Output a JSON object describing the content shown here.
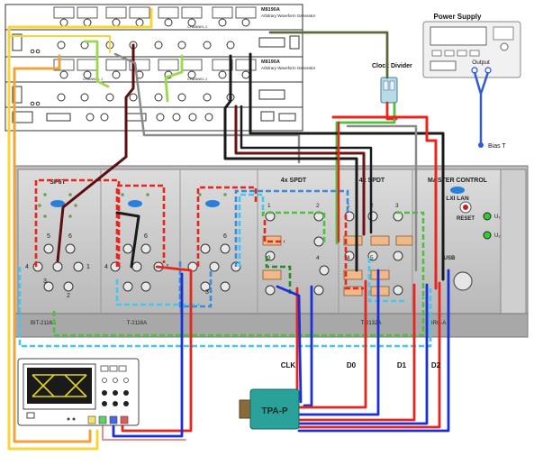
{
  "awg_units": [
    {
      "model": "M8190A",
      "subtitle": "Arbitrary Waveform Generator",
      "channel_a": "CHANNEL 1",
      "channel_b": "CHANNEL 2"
    },
    {
      "model": "M8190A",
      "subtitle": "Arbitrary Waveform Generator",
      "channel_a": "CHANNEL 1",
      "channel_b": "CHANNEL 2"
    }
  ],
  "power_supply": {
    "title": "Power Supply",
    "output_label": "Output"
  },
  "clock_divider": {
    "label": "Clock Divider"
  },
  "bias_t": {
    "label": "Bias T"
  },
  "switch_matrix": {
    "sections": [
      "SP6T",
      "4x SPDT",
      "4x SPDT",
      "MASTER CONTROL"
    ],
    "lxi_label": "LXI LAN",
    "reset_label": "RESET",
    "usb_label": "USB",
    "leds": [
      "U₁",
      "U₂"
    ],
    "bottom_labels": [
      "BIT-2116A",
      "T-2116A",
      "T-2132A",
      "BRC-A"
    ],
    "sp6t_ports": [
      "5",
      "6",
      "4",
      "1",
      "3",
      "2"
    ],
    "spdt_ports": [
      "1",
      "2",
      "3",
      "4",
      "1",
      "2",
      "3",
      "4",
      "5"
    ]
  },
  "signals": [
    "CLK",
    "D0",
    "D1",
    "D2"
  ],
  "probe": {
    "label": "TPA-P"
  },
  "colors": {
    "red": "#e8241c",
    "blue": "#1a2fd9",
    "black": "#1a1a1a",
    "darkred": "#6b1212",
    "gray": "#8a8a8a",
    "green": "#4cc13b",
    "yellow": "#f7d63a",
    "orange": "#f0a33a",
    "cyan": "#42c8f0"
  }
}
